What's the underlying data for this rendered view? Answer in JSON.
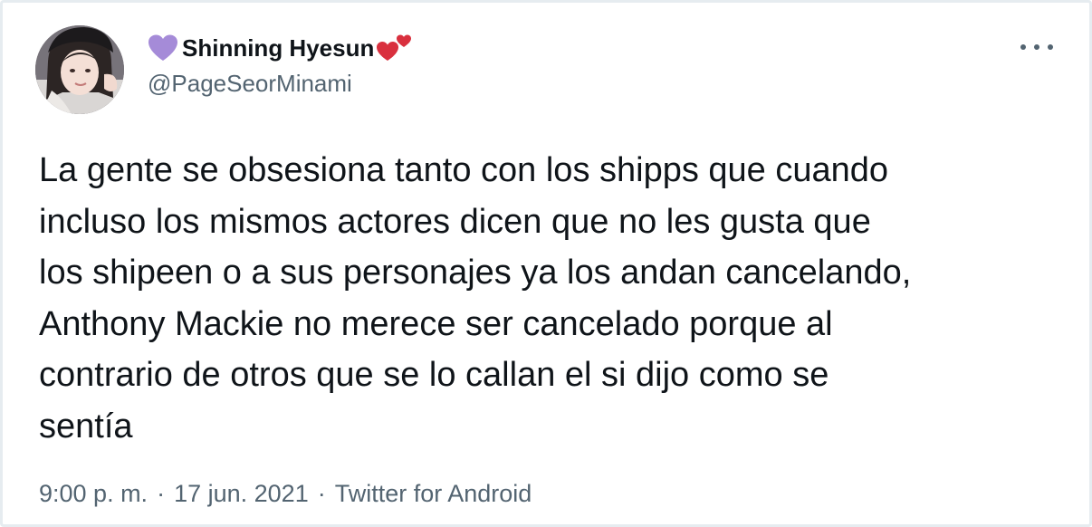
{
  "user": {
    "display_name": "Shinning Hyesun",
    "handle": "@PageSeorMinami",
    "name_prefix_emoji": "purple-heart-icon",
    "name_suffix_emoji": "two-hearts-icon",
    "avatar": "avatar"
  },
  "tweet": {
    "text": "La gente se obsesiona tanto con los shipps que cuando\nincluso los mismos actores dicen que no les gusta que\nlos shipeen o a sus personajes ya los andan cancelando,\nAnthony Mackie no merece ser cancelado porque al\ncontrario de otros que se lo callan el si dijo como se\nsentía"
  },
  "meta": {
    "time": "9:00 p. m.",
    "separator": "·",
    "date": "17 jun. 2021",
    "source": "Twitter for Android"
  },
  "icons": {
    "more": "more-options-icon"
  },
  "colors": {
    "text": "#0f1419",
    "secondary": "#536471",
    "border": "#e6ecf0",
    "purple_heart": "#a58bd8",
    "red_heart": "#d9303e"
  }
}
